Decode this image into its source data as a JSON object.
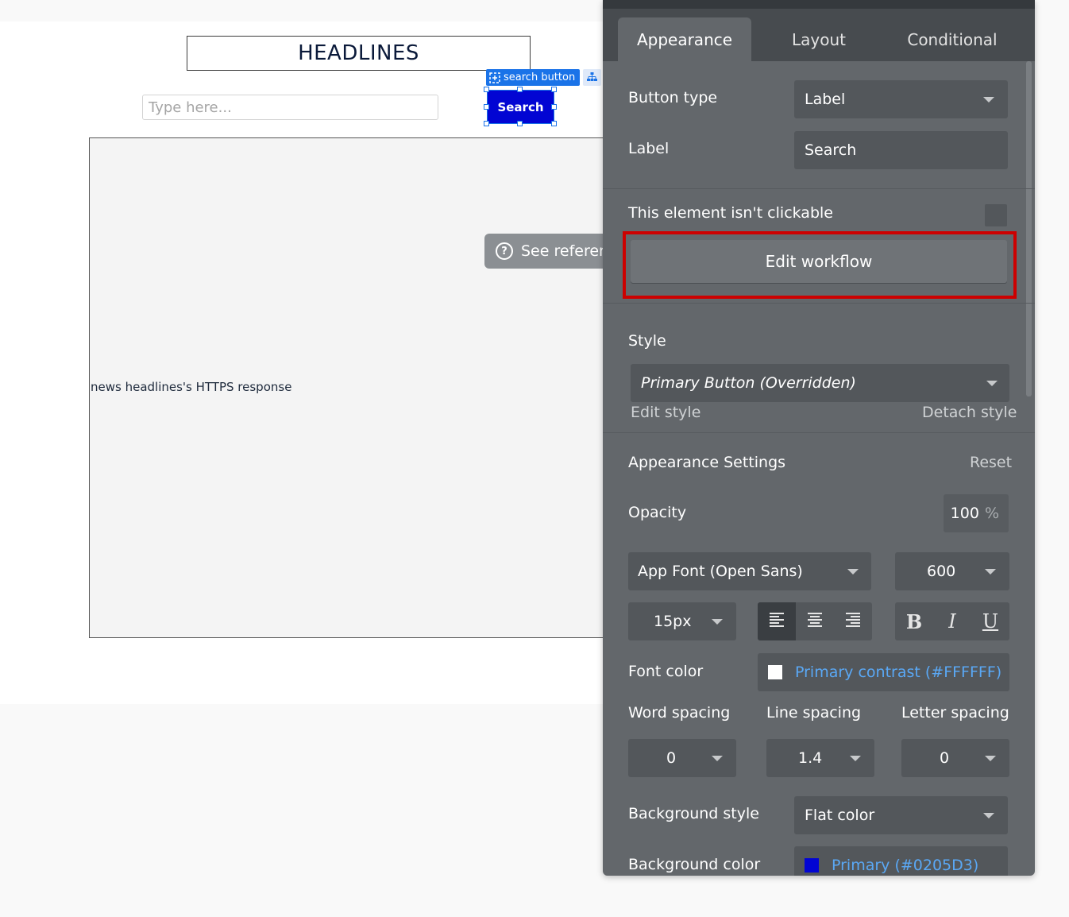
{
  "canvas": {
    "headline": "HEADLINES",
    "search_placeholder": "Type here...",
    "selection_tag": "search button",
    "search_button_label": "Search",
    "group_text": "news headlines's HTTPS response",
    "see_reference": "See reference"
  },
  "panel": {
    "tabs": [
      "Appearance",
      "Layout",
      "Conditional"
    ],
    "active_tab": "Appearance",
    "button_type_label": "Button type",
    "button_type_value": "Label",
    "label_label": "Label",
    "label_value": "Search",
    "not_clickable_label": "This element isn't clickable",
    "edit_workflow": "Edit workflow",
    "style_label": "Style",
    "style_value": "Primary Button (Overridden)",
    "edit_style": "Edit style",
    "detach_style": "Detach style",
    "appearance_settings": "Appearance Settings",
    "reset": "Reset",
    "opacity_label": "Opacity",
    "opacity_value": "100",
    "opacity_unit": "%",
    "font_family": "App Font (Open Sans)",
    "font_weight": "600",
    "font_size": "15px",
    "format_buttons": [
      "B",
      "I",
      "U"
    ],
    "font_color_label": "Font color",
    "font_color_value": "Primary contrast (#FFFFFF)",
    "font_color_hex": "#FFFFFF",
    "word_spacing_label": "Word spacing",
    "word_spacing_value": "0",
    "line_spacing_label": "Line spacing",
    "line_spacing_value": "1.4",
    "letter_spacing_label": "Letter spacing",
    "letter_spacing_value": "0",
    "background_style_label": "Background style",
    "background_style_value": "Flat color",
    "background_color_label": "Background color",
    "background_color_value": "Primary (#0205D3)",
    "background_color_hex": "#0205D3"
  },
  "colors": {
    "accent_selection": "#1a73e8",
    "highlight": "#cc0000",
    "link": "#5aa8f5"
  }
}
